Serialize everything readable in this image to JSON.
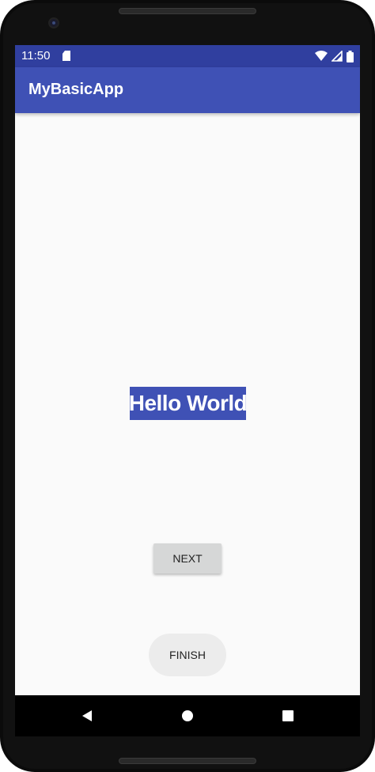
{
  "status_bar": {
    "time": "11:50",
    "icons": [
      "sd-card-icon",
      "wifi-icon",
      "signal-icon",
      "battery-icon"
    ]
  },
  "app_bar": {
    "title": "MyBasicApp"
  },
  "main": {
    "hello_text": "Hello World",
    "next_label": "NEXT",
    "finish_label": "FINISH"
  },
  "nav_bar": {
    "buttons": [
      "back-icon",
      "home-icon",
      "recents-icon"
    ]
  },
  "colors": {
    "status_bar": "#303f9f",
    "app_bar": "#3f51b5",
    "hello_bg": "#3f51b5",
    "background": "#fafafa"
  }
}
